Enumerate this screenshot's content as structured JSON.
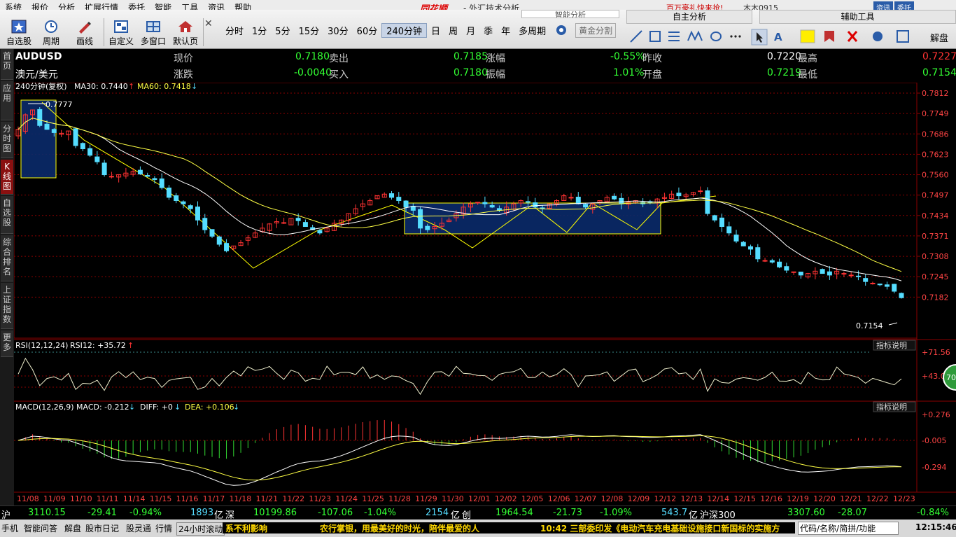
{
  "menu": [
    "系统",
    "报价",
    "分析",
    "扩展行情",
    "委托",
    "智能",
    "工具",
    "资讯",
    "帮助"
  ],
  "brand": "同花顺",
  "window_title": "- 外汇技术分析",
  "promo": "百万豪礼快来抢!",
  "user": "木木0915",
  "menubar_right": [
    "资讯",
    "委托"
  ],
  "toolbar": {
    "buttons": [
      {
        "label": "自选股",
        "icon": "star-icon"
      },
      {
        "label": "周期",
        "icon": "clock-icon"
      },
      {
        "label": "画线",
        "icon": "pen-icon"
      },
      {
        "label": "自定义",
        "icon": "custom-icon"
      },
      {
        "label": "多窗口",
        "icon": "multi-window-icon"
      },
      {
        "label": "默认页",
        "icon": "home-icon"
      }
    ],
    "periods": [
      "分时",
      "1分",
      "5分",
      "15分",
      "30分",
      "60分",
      "240分钟",
      "日",
      "周",
      "月",
      "季",
      "年",
      "多周期"
    ],
    "active_period": "240分钟",
    "split": "黄金分割"
  },
  "panel_tabs": [
    "智能分析",
    "自主分析",
    "辅助工具"
  ],
  "aux_labels": {
    "analysis": "解盘"
  },
  "left_tabs": [
    "首页",
    "应用",
    "分时图",
    "K线图",
    "自选股",
    "综合排名",
    "上证指数",
    "更多"
  ],
  "quote": {
    "symbol": "AUDUSD",
    "name": "澳元/美元",
    "labels": {
      "now": "现价",
      "change": "涨跌",
      "sell": "卖出",
      "buy": "买入",
      "pct": "涨幅",
      "amp": "振幅",
      "prev": "昨收",
      "open": "开盘",
      "high": "最高",
      "low": "最低"
    },
    "now": "0.7180",
    "change": "-0.0040",
    "sell": "0.7185",
    "buy": "0.7180",
    "pct": "-0.55%",
    "amp": "1.01%",
    "prev": "0.7220",
    "open": "0.7219",
    "high": "0.7227",
    "low": "0.7154"
  },
  "ma_line": {
    "period": "240分钟(复权)",
    "ma30": "MA30: 0.7440",
    "ma60": "MA60: 0.7418"
  },
  "rsi_line": {
    "label": "RSI(12,12,24)",
    "value": "RSI12: +35.72"
  },
  "macd_line": {
    "label": "MACD(12,26,9)",
    "macd": "MACD: -0.212",
    "diff": "DIFF: +0",
    "dea": "DEA: +0.106"
  },
  "indicator_help": "指标说明",
  "badge": "70",
  "colors": {
    "up": "#ff3333",
    "down": "#55ddff",
    "ma30": "#ffffff",
    "ma60": "#ffff44",
    "grid": "#8b0000",
    "accent": "#ffff00"
  },
  "chart_data": {
    "type": "candlestick",
    "y_ticks": [
      "0.7812",
      "0.7749",
      "0.7686",
      "0.7623",
      "0.7560",
      "0.7497",
      "0.7434",
      "0.7371",
      "0.7308",
      "0.7245",
      "0.7182"
    ],
    "ylim": [
      0.712,
      0.7812
    ],
    "high_label": "0.7777",
    "low_label": "0.7154",
    "rsi_ticks": [
      "+71.56",
      "+43.05"
    ],
    "macd_ticks": [
      "+0.276",
      "-0.005",
      "-0.294"
    ],
    "x_ticks": [
      "11/08",
      "11/09",
      "11/10",
      "11/11",
      "11/14",
      "11/15",
      "11/16",
      "11/17",
      "11/18",
      "11/21",
      "11/22",
      "11/23",
      "11/24",
      "11/25",
      "11/28",
      "11/29",
      "11/30",
      "12/01",
      "12/02",
      "12/05",
      "12/06",
      "12/07",
      "12/08",
      "12/09",
      "12/12",
      "12/13",
      "12/14",
      "12/15",
      "12/16",
      "12/19",
      "12/20",
      "12/21",
      "12/22",
      "12/23"
    ],
    "close_path": [
      0.77,
      0.7745,
      0.776,
      0.7712,
      0.77,
      0.769,
      0.7688,
      0.7695,
      0.765,
      0.764,
      0.762,
      0.76,
      0.756,
      0.7555,
      0.756,
      0.7565,
      0.757,
      0.7562,
      0.7555,
      0.7545,
      0.752,
      0.749,
      0.748,
      0.747,
      0.7455,
      0.742,
      0.739,
      0.737,
      0.7345,
      0.7325,
      0.734,
      0.735,
      0.7365,
      0.738,
      0.7395,
      0.7408,
      0.7415,
      0.7412,
      0.7425,
      0.7418,
      0.74,
      0.739,
      0.738,
      0.7395,
      0.741,
      0.742,
      0.744,
      0.7455,
      0.747,
      0.748,
      0.7495,
      0.75,
      0.749,
      0.748,
      0.746,
      0.745,
      0.7395,
      0.739,
      0.74,
      0.741,
      0.742,
      0.744,
      0.746,
      0.747,
      0.7475,
      0.747,
      0.746,
      0.745,
      0.746,
      0.747,
      0.748,
      0.7475,
      0.746,
      0.7455,
      0.747,
      0.748,
      0.7495,
      0.749,
      0.747,
      0.746,
      0.747,
      0.748,
      0.749,
      0.7485,
      0.747,
      0.7475,
      0.748,
      0.747,
      0.7475,
      0.7485,
      0.749,
      0.75,
      0.7495,
      0.7498,
      0.7505,
      0.751,
      0.744,
      0.742,
      0.74,
      0.738,
      0.7355,
      0.734,
      0.733,
      0.73,
      0.7295,
      0.729,
      0.7275,
      0.7265,
      0.726,
      0.725,
      0.7255,
      0.7262,
      0.7255,
      0.725,
      0.7262,
      0.7255,
      0.725,
      0.7245,
      0.723,
      0.7225,
      0.722,
      0.7215,
      0.72,
      0.718
    ]
  },
  "status": {
    "sh_label": "沪",
    "sh_index": "3110.15",
    "sh_chg": "-29.41",
    "sh_pct": "-0.94%",
    "sh_amt": "1893",
    "sh_unit": "亿",
    "sz_label": "深",
    "sz_index": "10199.86",
    "sz_chg": "-107.06",
    "sz_pct": "-1.04%",
    "sz_amt": "2154",
    "sz_unit": "亿",
    "cy_label": "创",
    "cy_index": "1964.54",
    "cy_chg": "-21.73",
    "cy_pct": "-1.09%",
    "cy_amt": "543.7",
    "cy_unit": "亿",
    "hs_label": "沪深300",
    "hs_index": "3307.60",
    "hs_chg": "-28.07",
    "hs_pct": "-0.84%"
  },
  "bottom": {
    "items": [
      "手机",
      "智能问答",
      "解盘",
      "股市日记",
      "股灵通",
      "行情",
      "24小时滚动"
    ],
    "ticker1": "系不利影响",
    "ticker2": "农行掌银，用最美好的时光，陪伴最爱的人",
    "ticker3": "10:42 三部委印发《电动汽车充电基础设施接口新国标的实施方",
    "search": "代码/名称/简拼/功能",
    "time": "12:15:46"
  }
}
